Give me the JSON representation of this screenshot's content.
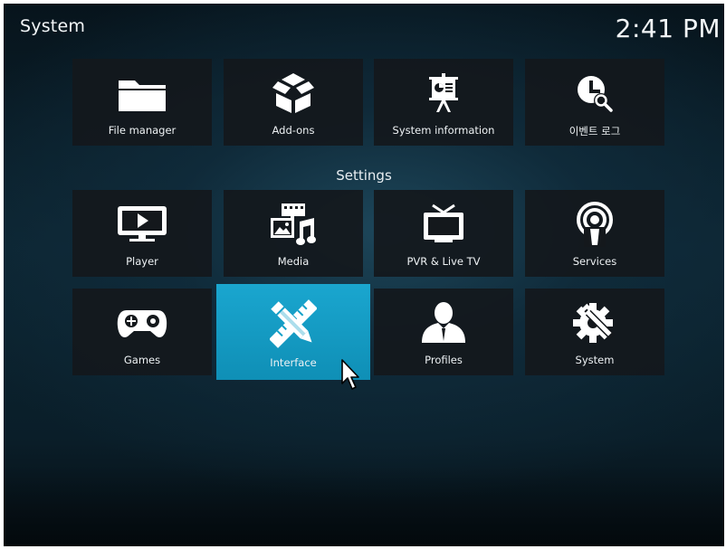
{
  "header": {
    "title": "System",
    "clock": "2:41 PM"
  },
  "top_row": [
    {
      "label": "File manager",
      "icon": "folder-icon"
    },
    {
      "label": "Add-ons",
      "icon": "open-box-icon"
    },
    {
      "label": "System information",
      "icon": "presentation-board-icon"
    },
    {
      "label": "이벤트 로그",
      "icon": "clock-search-icon"
    }
  ],
  "settings": {
    "heading": "Settings",
    "row1": [
      {
        "label": "Player",
        "icon": "monitor-play-icon"
      },
      {
        "label": "Media",
        "icon": "media-library-icon"
      },
      {
        "label": "PVR & Live TV",
        "icon": "tv-antenna-icon"
      },
      {
        "label": "Services",
        "icon": "podcast-icon"
      }
    ],
    "row2": [
      {
        "label": "Games",
        "icon": "gamepad-icon"
      },
      {
        "label": "Interface",
        "icon": "pencil-ruler-icon",
        "focused": true
      },
      {
        "label": "Profiles",
        "icon": "user-silhouette-icon"
      },
      {
        "label": "System",
        "icon": "gear-wrench-icon"
      }
    ]
  },
  "colors": {
    "focus": "#12a0c8",
    "tile": "#14181c",
    "text": "#eef2f4"
  }
}
